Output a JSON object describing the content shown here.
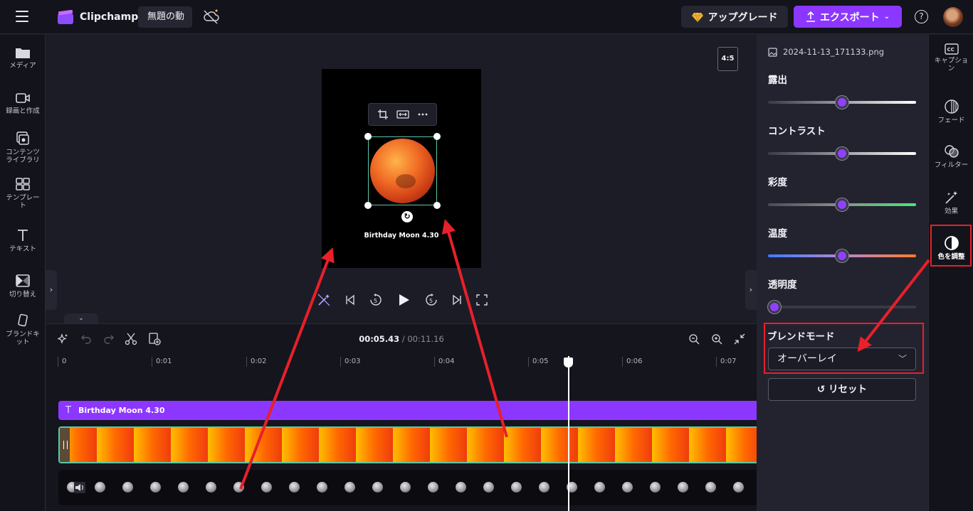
{
  "app": {
    "name": "Clipchamp",
    "project_title": "無題の動",
    "upgrade_label": "アップグレード",
    "export_label": "エクスポート",
    "help_glyph": "?"
  },
  "left_nav": [
    {
      "label": "メディア",
      "icon": "folder-icon"
    },
    {
      "label": "録画と作成",
      "icon": "camera-icon"
    },
    {
      "label": "コンテンツ\nライブラリ",
      "icon": "library-icon"
    },
    {
      "label": "テンプレー\nト",
      "icon": "template-icon"
    },
    {
      "label": "テキスト",
      "icon": "text-icon"
    },
    {
      "label": "切り替え",
      "icon": "transition-icon"
    },
    {
      "label": "ブランドキ\nット",
      "icon": "brand-kit-icon"
    }
  ],
  "stage": {
    "aspect_ratio": "4:5",
    "canvas_caption": "Birthday Moon 4.30"
  },
  "timeline": {
    "current_time": "00:05.43",
    "total_time": "/ 00:11.16",
    "ruler": [
      "0",
      "0:01",
      "0:02",
      "0:03",
      "0:04",
      "0:05",
      "0:06",
      "0:07"
    ],
    "text_track_label": "Birthday Moon 4.30",
    "text_track_glyph": "T"
  },
  "panel": {
    "file_name": "2024-11-13_171133.png",
    "adjustments": [
      {
        "label": "露出",
        "value": 0.5,
        "track": "linear-gradient(90deg,#3a3a46,#ffffff)"
      },
      {
        "label": "コントラスト",
        "value": 0.5,
        "track": "linear-gradient(90deg,#3a3a46,#ffffff)"
      },
      {
        "label": "彩度",
        "value": 0.5,
        "track": "linear-gradient(90deg,#4a4a52,#8a8a8a 45%,#48e87a)"
      },
      {
        "label": "温度",
        "value": 0.5,
        "track": "linear-gradient(90deg,#3f7bff,#b08ad0 50%,#ff7a2a)"
      },
      {
        "label": "透明度",
        "value": 0.0,
        "track": "linear-gradient(90deg,#3a3a46,#3a3a46)"
      }
    ],
    "blend_mode_label": "ブレンドモード",
    "blend_mode_value": "オーバーレイ",
    "reset_label": "リセット",
    "reset_glyph": "↺"
  },
  "right_rail": [
    {
      "label": "キャプショ\nン",
      "icon": "captions-icon"
    },
    {
      "label": "フェード",
      "icon": "fade-icon"
    },
    {
      "label": "フィルター",
      "icon": "filter-icon"
    },
    {
      "label": "効果",
      "icon": "effects-icon"
    },
    {
      "label": "色を調整",
      "icon": "color-adjust-icon"
    }
  ],
  "colors": {
    "accent": "#8c37ff",
    "selection": "#5bc8a6",
    "annotation": "#e8202a"
  }
}
